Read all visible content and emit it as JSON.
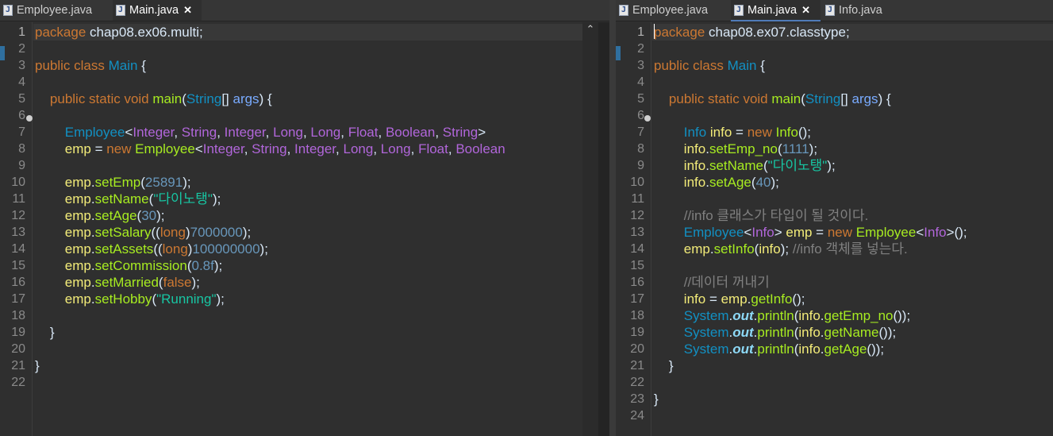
{
  "left_editor": {
    "tabs": [
      {
        "label": "Employee.java",
        "active": false
      },
      {
        "label": "Main.java",
        "active": true,
        "closable": true
      }
    ],
    "lines": [
      [
        [
          "k",
          "package"
        ],
        [
          "w",
          " chap08.ex06.multi;"
        ]
      ],
      [],
      [
        [
          "k",
          "public class "
        ],
        [
          "t",
          "Main"
        ],
        [
          "w",
          " {"
        ]
      ],
      [],
      [
        [
          "w",
          "    "
        ],
        [
          "k",
          "public static void "
        ],
        [
          "m",
          "main"
        ],
        [
          "w",
          "("
        ],
        [
          "t",
          "String"
        ],
        [
          "w",
          "[] "
        ],
        [
          "p",
          "args"
        ],
        [
          "w",
          ") {"
        ]
      ],
      [],
      [
        [
          "w",
          "        "
        ],
        [
          "t",
          "Employee"
        ],
        [
          "w",
          "<"
        ],
        [
          "g",
          "Integer"
        ],
        [
          "w",
          ", "
        ],
        [
          "g",
          "String"
        ],
        [
          "w",
          ", "
        ],
        [
          "g",
          "Integer"
        ],
        [
          "w",
          ", "
        ],
        [
          "g",
          "Long"
        ],
        [
          "w",
          ", "
        ],
        [
          "g",
          "Long"
        ],
        [
          "w",
          ", "
        ],
        [
          "g",
          "Float"
        ],
        [
          "w",
          ", "
        ],
        [
          "g",
          "Boolean"
        ],
        [
          "w",
          ", "
        ],
        [
          "g",
          "String"
        ],
        [
          "w",
          ">"
        ]
      ],
      [
        [
          "w",
          "        "
        ],
        [
          "v",
          "emp"
        ],
        [
          "w",
          " = "
        ],
        [
          "k",
          "new "
        ],
        [
          "m",
          "Employee"
        ],
        [
          "w",
          "<"
        ],
        [
          "g",
          "Integer"
        ],
        [
          "w",
          ", "
        ],
        [
          "g",
          "String"
        ],
        [
          "w",
          ", "
        ],
        [
          "g",
          "Integer"
        ],
        [
          "w",
          ", "
        ],
        [
          "g",
          "Long"
        ],
        [
          "w",
          ", "
        ],
        [
          "g",
          "Long"
        ],
        [
          "w",
          ", "
        ],
        [
          "g",
          "Float"
        ],
        [
          "w",
          ", "
        ],
        [
          "g",
          "Boolean"
        ]
      ],
      [],
      [
        [
          "w",
          "        "
        ],
        [
          "v",
          "emp"
        ],
        [
          "w",
          "."
        ],
        [
          "m",
          "setEmp"
        ],
        [
          "w",
          "("
        ],
        [
          "n",
          "25891"
        ],
        [
          "w",
          ");"
        ]
      ],
      [
        [
          "w",
          "        "
        ],
        [
          "v",
          "emp"
        ],
        [
          "w",
          "."
        ],
        [
          "m",
          "setName"
        ],
        [
          "w",
          "("
        ],
        [
          "s",
          "\"다이노탱\""
        ],
        [
          "w",
          ");"
        ]
      ],
      [
        [
          "w",
          "        "
        ],
        [
          "v",
          "emp"
        ],
        [
          "w",
          "."
        ],
        [
          "m",
          "setAge"
        ],
        [
          "w",
          "("
        ],
        [
          "n",
          "30"
        ],
        [
          "w",
          ");"
        ]
      ],
      [
        [
          "w",
          "        "
        ],
        [
          "v",
          "emp"
        ],
        [
          "w",
          "."
        ],
        [
          "m",
          "setSalary"
        ],
        [
          "w",
          "(("
        ],
        [
          "k",
          "long"
        ],
        [
          "w",
          ")"
        ],
        [
          "n",
          "7000000"
        ],
        [
          "w",
          ");"
        ]
      ],
      [
        [
          "w",
          "        "
        ],
        [
          "v",
          "emp"
        ],
        [
          "w",
          "."
        ],
        [
          "m",
          "setAssets"
        ],
        [
          "w",
          "(("
        ],
        [
          "k",
          "long"
        ],
        [
          "w",
          ")"
        ],
        [
          "n",
          "100000000"
        ],
        [
          "w",
          ");"
        ]
      ],
      [
        [
          "w",
          "        "
        ],
        [
          "v",
          "emp"
        ],
        [
          "w",
          "."
        ],
        [
          "m",
          "setCommission"
        ],
        [
          "w",
          "("
        ],
        [
          "n",
          "0.8f"
        ],
        [
          "w",
          ");"
        ]
      ],
      [
        [
          "w",
          "        "
        ],
        [
          "v",
          "emp"
        ],
        [
          "w",
          "."
        ],
        [
          "m",
          "setMarried"
        ],
        [
          "w",
          "("
        ],
        [
          "k",
          "false"
        ],
        [
          "w",
          ");"
        ]
      ],
      [
        [
          "w",
          "        "
        ],
        [
          "v",
          "emp"
        ],
        [
          "w",
          "."
        ],
        [
          "m",
          "setHobby"
        ],
        [
          "w",
          "("
        ],
        [
          "s",
          "\"Running\""
        ],
        [
          "w",
          ");"
        ]
      ],
      [],
      [
        [
          "w",
          "    }"
        ]
      ],
      [],
      [
        [
          "w",
          "}"
        ]
      ],
      []
    ],
    "line_numbers": [
      "1",
      "2",
      "3",
      "4",
      "5",
      "6",
      "7",
      "8",
      "9",
      "10",
      "11",
      "12",
      "13",
      "14",
      "15",
      "16",
      "17",
      "18",
      "19",
      "20",
      "21",
      "22"
    ]
  },
  "right_editor": {
    "tabs": [
      {
        "label": "Employee.java",
        "active": false
      },
      {
        "label": "Main.java",
        "active": true,
        "closable": true
      },
      {
        "label": "Info.java",
        "active": false
      }
    ],
    "lines": [
      [
        [
          "k",
          "package"
        ],
        [
          "w",
          " chap08.ex07.classtype;"
        ]
      ],
      [],
      [
        [
          "k",
          "public class "
        ],
        [
          "t",
          "Main"
        ],
        [
          "w",
          " {"
        ]
      ],
      [],
      [
        [
          "w",
          "    "
        ],
        [
          "k",
          "public static void "
        ],
        [
          "m",
          "main"
        ],
        [
          "w",
          "("
        ],
        [
          "t",
          "String"
        ],
        [
          "w",
          "[] "
        ],
        [
          "p",
          "args"
        ],
        [
          "w",
          ") {"
        ]
      ],
      [],
      [
        [
          "w",
          "        "
        ],
        [
          "t",
          "Info"
        ],
        [
          "w",
          " "
        ],
        [
          "v",
          "info"
        ],
        [
          "w",
          " = "
        ],
        [
          "k",
          "new "
        ],
        [
          "m",
          "Info"
        ],
        [
          "w",
          "();"
        ]
      ],
      [
        [
          "w",
          "        "
        ],
        [
          "v",
          "info"
        ],
        [
          "w",
          "."
        ],
        [
          "m",
          "setEmp_no"
        ],
        [
          "w",
          "("
        ],
        [
          "n",
          "1111"
        ],
        [
          "w",
          ");"
        ]
      ],
      [
        [
          "w",
          "        "
        ],
        [
          "v",
          "info"
        ],
        [
          "w",
          "."
        ],
        [
          "m",
          "setName"
        ],
        [
          "w",
          "("
        ],
        [
          "s",
          "\"다이노탱\""
        ],
        [
          "w",
          ");"
        ]
      ],
      [
        [
          "w",
          "        "
        ],
        [
          "v",
          "info"
        ],
        [
          "w",
          "."
        ],
        [
          "m",
          "setAge"
        ],
        [
          "w",
          "("
        ],
        [
          "n",
          "40"
        ],
        [
          "w",
          ");"
        ]
      ],
      [],
      [
        [
          "w",
          "        "
        ],
        [
          "c",
          "//info 클래스가 타입이 될 것이다."
        ]
      ],
      [
        [
          "w",
          "        "
        ],
        [
          "t",
          "Employee"
        ],
        [
          "w",
          "<"
        ],
        [
          "g",
          "Info"
        ],
        [
          "w",
          "> "
        ],
        [
          "v",
          "emp"
        ],
        [
          "w",
          " = "
        ],
        [
          "k",
          "new "
        ],
        [
          "m",
          "Employee"
        ],
        [
          "w",
          "<"
        ],
        [
          "g",
          "Info"
        ],
        [
          "w",
          ">();"
        ]
      ],
      [
        [
          "w",
          "        "
        ],
        [
          "v",
          "emp"
        ],
        [
          "w",
          "."
        ],
        [
          "m",
          "setInfo"
        ],
        [
          "w",
          "("
        ],
        [
          "v",
          "info"
        ],
        [
          "w",
          "); "
        ],
        [
          "c",
          "//info 객체를 넣는다."
        ]
      ],
      [],
      [
        [
          "w",
          "        "
        ],
        [
          "c",
          "//데이터 꺼내기"
        ]
      ],
      [
        [
          "w",
          "        "
        ],
        [
          "v",
          "info"
        ],
        [
          "w",
          " = "
        ],
        [
          "v",
          "emp"
        ],
        [
          "w",
          "."
        ],
        [
          "m",
          "getInfo"
        ],
        [
          "w",
          "();"
        ]
      ],
      [
        [
          "w",
          "        "
        ],
        [
          "t",
          "System"
        ],
        [
          "w",
          "."
        ],
        [
          "ob",
          "out"
        ],
        [
          "w",
          "."
        ],
        [
          "m",
          "println"
        ],
        [
          "w",
          "("
        ],
        [
          "v",
          "info"
        ],
        [
          "w",
          "."
        ],
        [
          "m",
          "getEmp_no"
        ],
        [
          "w",
          "());"
        ]
      ],
      [
        [
          "w",
          "        "
        ],
        [
          "t",
          "System"
        ],
        [
          "w",
          "."
        ],
        [
          "ob",
          "out"
        ],
        [
          "w",
          "."
        ],
        [
          "m",
          "println"
        ],
        [
          "w",
          "("
        ],
        [
          "v",
          "info"
        ],
        [
          "w",
          "."
        ],
        [
          "m",
          "getName"
        ],
        [
          "w",
          "());"
        ]
      ],
      [
        [
          "w",
          "        "
        ],
        [
          "t",
          "System"
        ],
        [
          "w",
          "."
        ],
        [
          "ob",
          "out"
        ],
        [
          "w",
          "."
        ],
        [
          "m",
          "println"
        ],
        [
          "w",
          "("
        ],
        [
          "v",
          "info"
        ],
        [
          "w",
          "."
        ],
        [
          "m",
          "getAge"
        ],
        [
          "w",
          "());"
        ]
      ],
      [
        [
          "w",
          "    }"
        ]
      ],
      [],
      [
        [
          "w",
          "}"
        ]
      ],
      []
    ],
    "line_numbers": [
      "1",
      "2",
      "3",
      "4",
      "5",
      "6",
      "7",
      "8",
      "9",
      "10",
      "11",
      "12",
      "13",
      "14",
      "15",
      "16",
      "17",
      "18",
      "19",
      "20",
      "21",
      "22",
      "23",
      "24"
    ]
  },
  "icons": {
    "java_file": "java-file-icon",
    "close": "close-icon",
    "scroll_up": "scroll-up-arrow-icon",
    "fold": "fold-collapse-icon"
  },
  "glyphs": {
    "java": "J",
    "close": "✕",
    "up": "⌃"
  },
  "colors": {
    "background": "#2f2f2f",
    "keyword": "#cc7832",
    "type": "#1290c3",
    "method": "#a7ec21",
    "generic_type": "#b166da",
    "variable": "#f3ec79",
    "number": "#6897bb",
    "string": "#17c6a3",
    "comment": "#808080"
  }
}
